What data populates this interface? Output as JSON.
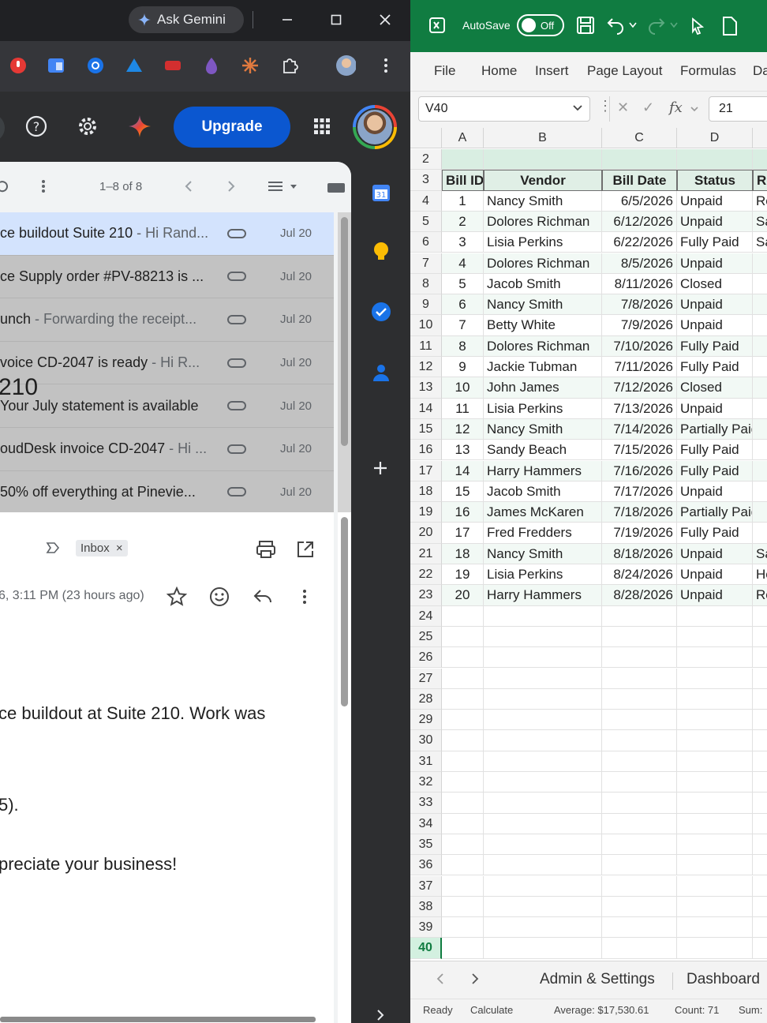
{
  "chrome": {
    "gemini_label": "Ask Gemini",
    "upgrade_label": "Upgrade"
  },
  "gmail": {
    "pager": "1–8 of 8",
    "rows": [
      {
        "subject": "ce buildout Suite 210",
        "snippet": " - Hi Rand...",
        "date": "Jul 20"
      },
      {
        "subject": "ce Supply order #PV-88213 is ...",
        "snippet": "",
        "date": "Jul 20"
      },
      {
        "subject": "unch",
        "snippet": " - Forwarding the receipt...",
        "date": "Jul 20"
      },
      {
        "subject": "voice CD-2047 is ready",
        "snippet": " - Hi R...",
        "date": "Jul 20"
      },
      {
        "subject": " Your July statement is available",
        "snippet": "",
        "date": "Jul 20"
      },
      {
        "subject": "oudDesk invoice CD-2047",
        "snippet": " - Hi ...",
        "date": "Jul 20"
      },
      {
        "subject": "50% off everything at Pinevie...",
        "snippet": "",
        "date": "Jul 20"
      }
    ],
    "reading": {
      "subject": "210",
      "badge": "Inbox",
      "time": "6, 3:11 PM (23 hours ago)",
      "lines": [
        "ce buildout at Suite 210. Work was",
        "5).",
        "preciate your business!"
      ]
    }
  },
  "excel": {
    "autosave_label": "AutoSave",
    "toggle_label": "Off",
    "menu": [
      "File",
      "Home",
      "Insert",
      "Page Layout",
      "Formulas",
      "Da"
    ],
    "name_box": "V40",
    "formula_value": "21",
    "columns": [
      "A",
      "B",
      "C",
      "D"
    ],
    "headers": [
      "Bill ID",
      "Vendor",
      "Bill Date",
      "Status",
      "Re"
    ],
    "rows": [
      [
        "1",
        "Nancy Smith",
        "6/5/2026",
        "Unpaid",
        "Re"
      ],
      [
        "2",
        "Dolores Richman",
        "6/12/2026",
        "Unpaid",
        "Sa"
      ],
      [
        "3",
        "Lisia Perkins",
        "6/22/2026",
        "Fully Paid",
        "Sa"
      ],
      [
        "4",
        "Dolores Richman",
        "8/5/2026",
        "Unpaid",
        ""
      ],
      [
        "5",
        "Jacob Smith",
        "8/11/2026",
        "Closed",
        ""
      ],
      [
        "6",
        "Nancy Smith",
        "7/8/2026",
        "Unpaid",
        ""
      ],
      [
        "7",
        "Betty White",
        "7/9/2026",
        "Unpaid",
        ""
      ],
      [
        "8",
        "Dolores Richman",
        "7/10/2026",
        "Fully Paid",
        ""
      ],
      [
        "9",
        "Jackie Tubman",
        "7/11/2026",
        "Fully Paid",
        ""
      ],
      [
        "10",
        "John James",
        "7/12/2026",
        "Closed",
        ""
      ],
      [
        "11",
        "Lisia Perkins",
        "7/13/2026",
        "Unpaid",
        ""
      ],
      [
        "12",
        "Nancy Smith",
        "7/14/2026",
        "Partially Paid",
        ""
      ],
      [
        "13",
        "Sandy Beach",
        "7/15/2026",
        "Fully Paid",
        ""
      ],
      [
        "14",
        "Harry Hammers",
        "7/16/2026",
        "Fully Paid",
        ""
      ],
      [
        "15",
        "Jacob Smith",
        "7/17/2026",
        "Unpaid",
        ""
      ],
      [
        "16",
        "James McKaren",
        "7/18/2026",
        "Partially Paid",
        ""
      ],
      [
        "17",
        "Fred Fredders",
        "7/19/2026",
        "Fully Paid",
        ""
      ],
      [
        "18",
        "Nancy Smith",
        "8/18/2026",
        "Unpaid",
        "Sa"
      ],
      [
        "19",
        "Lisia Perkins",
        "8/24/2026",
        "Unpaid",
        "He"
      ],
      [
        "20",
        "Harry Hammers",
        "8/28/2026",
        "Unpaid",
        "Re"
      ]
    ],
    "row_numbers": [
      "2",
      "3",
      "4",
      "5",
      "6",
      "7",
      "8",
      "9",
      "10",
      "11",
      "12",
      "13",
      "14",
      "15",
      "16",
      "17",
      "18",
      "19",
      "20",
      "21",
      "22",
      "23",
      "24",
      "25",
      "26",
      "27",
      "28",
      "29",
      "30",
      "31",
      "32",
      "33",
      "34",
      "35",
      "36",
      "37",
      "38",
      "39",
      "40"
    ],
    "tabs": [
      "Admin & Settings",
      "Dashboard"
    ],
    "status": {
      "ready": "Ready",
      "calculate": "Calculate",
      "average": "Average: $17,530.61",
      "count": "Count: 71",
      "sum": "Sum:"
    },
    "colors": {
      "brand": "#107c41",
      "header_fill": "#e0efe6"
    }
  }
}
